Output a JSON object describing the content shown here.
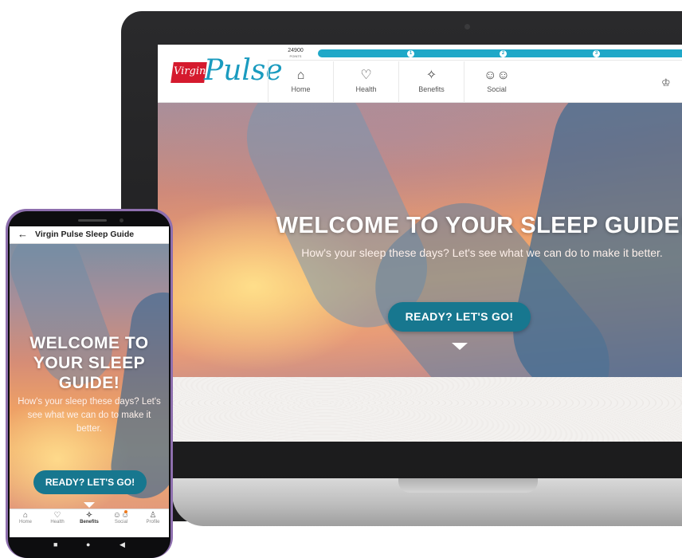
{
  "laptop": {
    "brand": {
      "script_word": "Virgin",
      "product_word": "Pulse"
    },
    "points": {
      "value": "24900",
      "label": "POINTS"
    },
    "progress_steps": [
      "1",
      "2",
      "3"
    ],
    "nav": [
      {
        "label": "Home",
        "icon": "home-icon"
      },
      {
        "label": "Health",
        "icon": "heart-icon"
      },
      {
        "label": "Benefits",
        "icon": "benefits-hand-icon"
      },
      {
        "label": "Social",
        "icon": "people-icon"
      }
    ],
    "trophy_icon": "trophy-icon",
    "hero": {
      "title": "WELCOME TO YOUR SLEEP GUIDE!",
      "subtitle": "How's your sleep these days? Let's see what we can do to make it better.",
      "cta": "READY? LET'S GO!"
    }
  },
  "phone": {
    "header_title": "Virgin Pulse Sleep Guide",
    "hero": {
      "title": "WELCOME TO YOUR SLEEP GUIDE!",
      "subtitle": "How's your sleep these days? Let's see what we can do to make it better.",
      "cta": "READY? LET'S GO!"
    },
    "nav": [
      {
        "label": "Home",
        "icon": "home-icon"
      },
      {
        "label": "Health",
        "icon": "heart-icon"
      },
      {
        "label": "Benefits",
        "icon": "benefits-hand-icon",
        "active": true
      },
      {
        "label": "Social",
        "icon": "people-icon",
        "badge": true
      },
      {
        "label": "Profile",
        "icon": "person-icon"
      }
    ]
  },
  "colors": {
    "accent": "#1FA8C8",
    "cta": "#17778F",
    "brand_red": "#D51A2E",
    "badge": "#EF7B1E"
  }
}
